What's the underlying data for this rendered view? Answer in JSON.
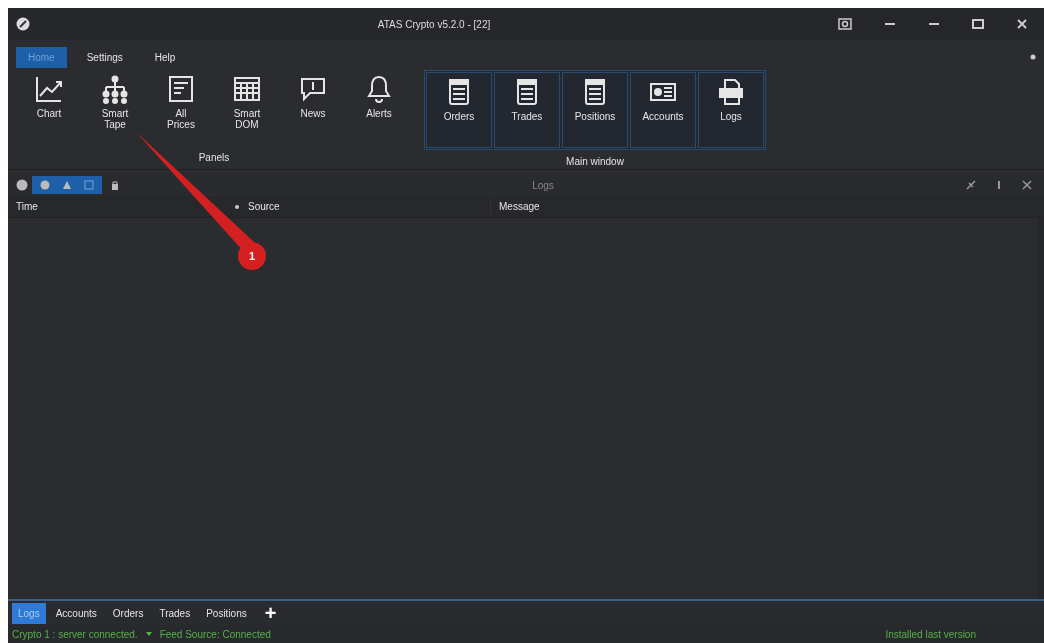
{
  "window": {
    "title": "ATAS Crypto v5.2.0 - [22]"
  },
  "menu_tabs": [
    {
      "label": "Home",
      "selected": true
    },
    {
      "label": "Settings",
      "selected": false
    },
    {
      "label": "Help",
      "selected": false
    }
  ],
  "ribbon_groups": [
    {
      "label": "Panels",
      "kind": "plain",
      "items": [
        {
          "label": "Chart",
          "kind": "chart"
        },
        {
          "label": "Smart\nTape",
          "kind": "tree"
        },
        {
          "label": "All\nPrices",
          "kind": "doc"
        },
        {
          "label": "Smart\nDOM",
          "kind": "grid"
        },
        {
          "label": "News",
          "kind": "bubble"
        },
        {
          "label": "Alerts",
          "kind": "bell"
        }
      ]
    },
    {
      "label": "Main window",
      "kind": "boxed",
      "items": [
        {
          "label": "Orders",
          "kind": "list"
        },
        {
          "label": "Trades",
          "kind": "list"
        },
        {
          "label": "Positions",
          "kind": "list"
        },
        {
          "label": "Accounts",
          "kind": "card"
        },
        {
          "label": "Logs",
          "kind": "printer"
        }
      ]
    }
  ],
  "panel": {
    "title": "Logs",
    "columns": [
      "Time",
      "Source",
      "Message"
    ]
  },
  "bottom_tabs": [
    {
      "label": "Logs",
      "selected": true
    },
    {
      "label": "Accounts",
      "selected": false
    },
    {
      "label": "Orders",
      "selected": false
    },
    {
      "label": "Trades",
      "selected": false
    },
    {
      "label": "Positions",
      "selected": false
    }
  ],
  "add_tab": "+",
  "status_bar": {
    "connection": "Crypto 1 : server connected.",
    "feed": "Feed Source: Connected",
    "version": "Installed last version"
  },
  "annotation": {
    "badge": "1"
  }
}
